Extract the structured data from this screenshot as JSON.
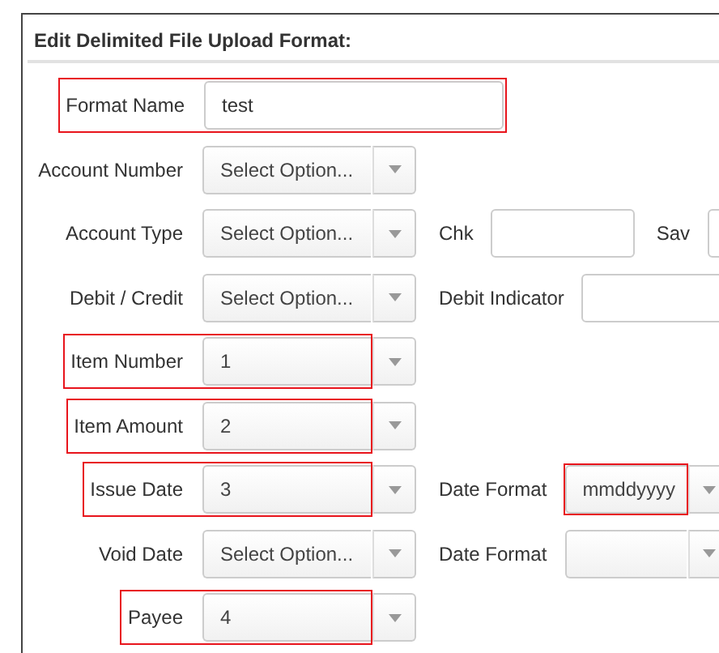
{
  "title": "Edit Delimited File Upload Format:",
  "rows": [
    {
      "label": "Format Name",
      "kind": "text",
      "value": "test",
      "highlighted": true
    },
    {
      "label": "Account Number",
      "kind": "select",
      "value": "Select Option...",
      "highlighted": false
    },
    {
      "label": "Account Type",
      "kind": "select",
      "value": "Select Option...",
      "highlighted": false,
      "extras": [
        {
          "label": "Chk",
          "kind": "text",
          "highlighted": false
        },
        {
          "label": "Sav",
          "kind": "text",
          "highlighted": false
        }
      ]
    },
    {
      "label": "Debit / Credit",
      "kind": "select",
      "value": "Select Option...",
      "highlighted": false,
      "extras": [
        {
          "label": "Debit Indicator",
          "kind": "text",
          "highlighted": false
        }
      ]
    },
    {
      "label": "Item Number",
      "kind": "select",
      "value": "1",
      "highlighted": true
    },
    {
      "label": "Item Amount",
      "kind": "select",
      "value": "2",
      "highlighted": true
    },
    {
      "label": "Issue Date",
      "kind": "select",
      "value": "3",
      "highlighted": true,
      "extras": [
        {
          "label": "Date Format",
          "kind": "select",
          "value": "mmddyyyy",
          "highlighted": true
        }
      ]
    },
    {
      "label": "Void Date",
      "kind": "select",
      "value": "Select Option...",
      "highlighted": false,
      "extras": [
        {
          "label": "Date Format",
          "kind": "select",
          "highlighted": false
        }
      ]
    },
    {
      "label": "Payee",
      "kind": "select",
      "value": "4",
      "highlighted": true
    }
  ]
}
